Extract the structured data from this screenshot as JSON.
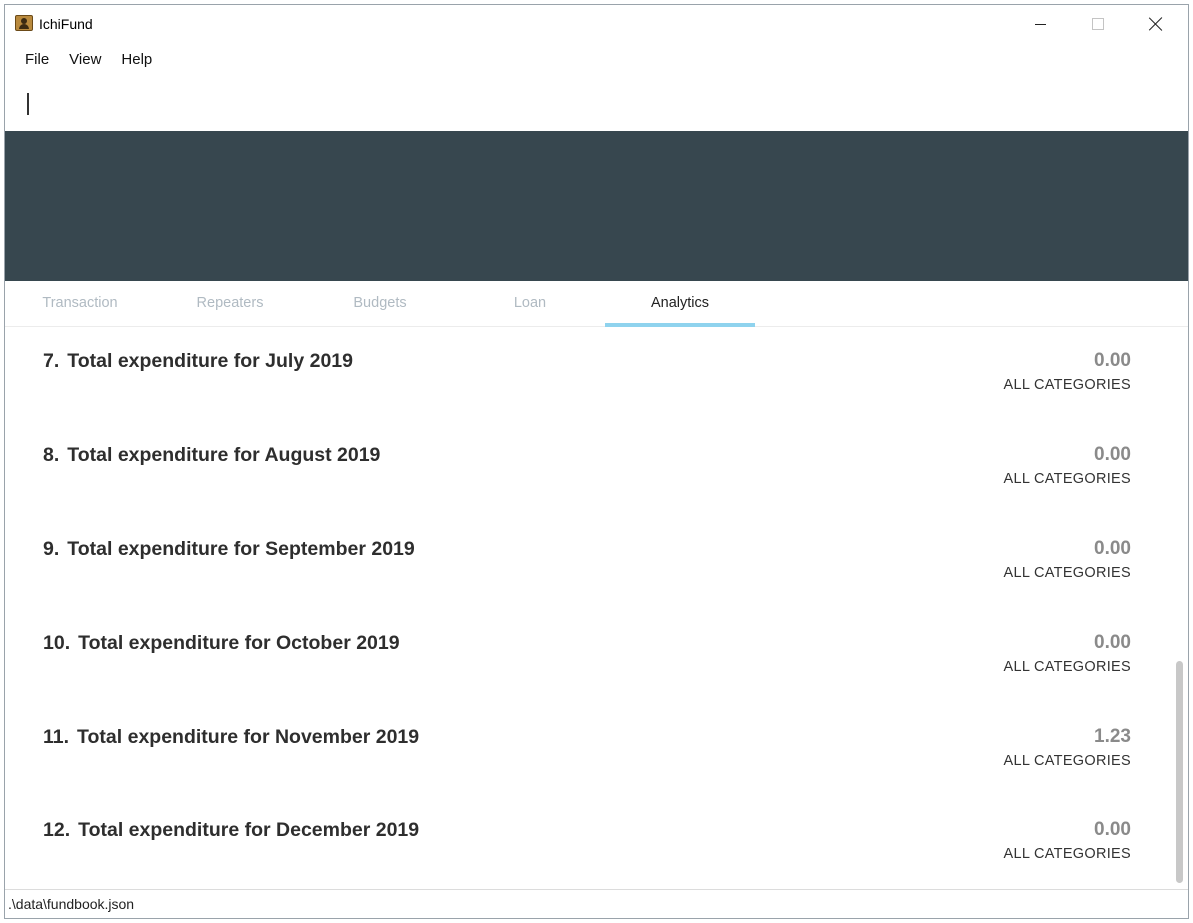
{
  "window": {
    "title": "IchiFund",
    "icon": "app-icon"
  },
  "menu": {
    "items": [
      "File",
      "View",
      "Help"
    ]
  },
  "command_box": {
    "value": "",
    "placeholder": ""
  },
  "tabs": [
    {
      "label": "Transaction",
      "active": false
    },
    {
      "label": "Repeaters",
      "active": false
    },
    {
      "label": "Budgets",
      "active": false
    },
    {
      "label": "Loan",
      "active": false
    },
    {
      "label": "Analytics",
      "active": true
    }
  ],
  "analytics": {
    "items": [
      {
        "index": "7.",
        "title": "Total expenditure for July 2019",
        "value": "0.00",
        "category": "ALL CATEGORIES"
      },
      {
        "index": "8.",
        "title": "Total expenditure for August 2019",
        "value": "0.00",
        "category": "ALL CATEGORIES"
      },
      {
        "index": "9.",
        "title": "Total expenditure for September 2019",
        "value": "0.00",
        "category": "ALL CATEGORIES"
      },
      {
        "index": "10.",
        "title": "Total expenditure for October 2019",
        "value": "0.00",
        "category": "ALL CATEGORIES"
      },
      {
        "index": "11.",
        "title": "Total expenditure for November 2019",
        "value": "1.23",
        "category": "ALL CATEGORIES"
      },
      {
        "index": "12.",
        "title": "Total expenditure for December 2019",
        "value": "0.00",
        "category": "ALL CATEGORIES"
      }
    ]
  },
  "status_bar": {
    "file_path": ".\\data\\fundbook.json"
  },
  "colors": {
    "result_display_bg": "#37474f",
    "tab_indicator": "#8fd3ee",
    "inactive_tab_text": "#b0bac2",
    "value_text": "#8a8a8a"
  }
}
